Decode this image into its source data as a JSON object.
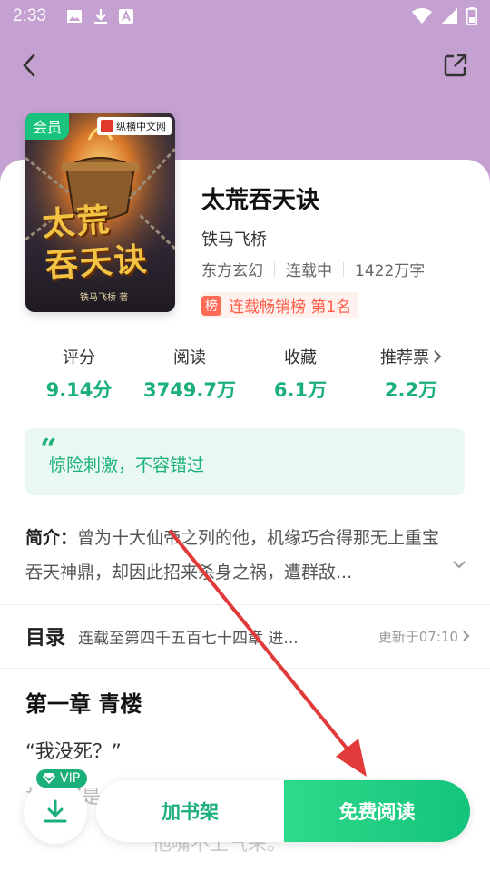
{
  "status": {
    "time": "2:33"
  },
  "book": {
    "cover_badge": "会员",
    "publisher": "纵横中文网",
    "cover_title_line1": "太荒",
    "cover_title_line2": "吞天诀",
    "cover_author": "铁马飞桥  著",
    "title": "太荒吞天诀",
    "author": "铁马飞桥",
    "genre": "东方玄幻",
    "status": "连载中",
    "word_count": "1422万字",
    "rank_badge": "榜",
    "rank_text": "连载畅销榜 第1名"
  },
  "stats": [
    {
      "label": "评分",
      "value": "9.14分"
    },
    {
      "label": "阅读",
      "value": "3749.7万"
    },
    {
      "label": "收藏",
      "value": "6.1万"
    },
    {
      "label": "推荐票",
      "value": "2.2万"
    }
  ],
  "quote": {
    "text": "惊险刺激，不容错过"
  },
  "intro": {
    "label": "简介：",
    "text": "曾为十大仙帝之列的他，机缘巧合得那无上重宝吞天神鼎，却因此招来杀身之祸，遭群敌..."
  },
  "toc": {
    "title": "目录",
    "latest": "连载至第四千五百七十四章 进...",
    "updated": "更新于07:10"
  },
  "chapter": {
    "title": "第一章 青楼",
    "line1": "“我没死？”",
    "line2": "林...那是...",
    "line3": "他嘴不上气来。"
  },
  "bottom": {
    "vip": "VIP",
    "shelf": "加书架",
    "read": "免费阅读"
  },
  "colors": {
    "accent": "#1bb07a",
    "header_bg": "#c4a1d0",
    "rank": "#ff5b45",
    "annotation": "#e03a3a"
  }
}
